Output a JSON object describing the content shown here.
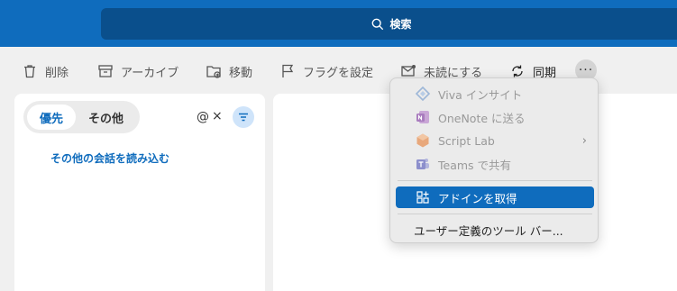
{
  "search": {
    "label": "検索",
    "icon": "search-icon"
  },
  "toolbar": {
    "delete": "削除",
    "archive": "アーカイブ",
    "move": "移動",
    "flag": "フラグを設定",
    "mark_unread": "未読にする",
    "sync": "同期",
    "more": "···"
  },
  "pivot": {
    "focused": "優先",
    "other": "その他"
  },
  "list": {
    "mention": "@",
    "close": "×",
    "load_more": "その他の会話を読み込む"
  },
  "menu": {
    "items": [
      {
        "label": "Viva インサイト",
        "icon": "viva-insights-icon",
        "enabled": false
      },
      {
        "label": "OneNote に送る",
        "icon": "onenote-icon",
        "enabled": false
      },
      {
        "label": "Script Lab",
        "icon": "script-lab-icon",
        "enabled": false,
        "submenu": true
      },
      {
        "label": "Teams で共有",
        "icon": "teams-icon",
        "enabled": false
      },
      {
        "label": "アドインを取得",
        "icon": "add-ins-icon",
        "enabled": true,
        "selected": true
      },
      {
        "label": "ユーザー定義のツール バー...",
        "enabled": true
      }
    ],
    "chevron": "›"
  },
  "colors": {
    "accent": "#0f6cbd",
    "topbar": "#0f6cbd",
    "search_bg": "#0a4f8c"
  }
}
